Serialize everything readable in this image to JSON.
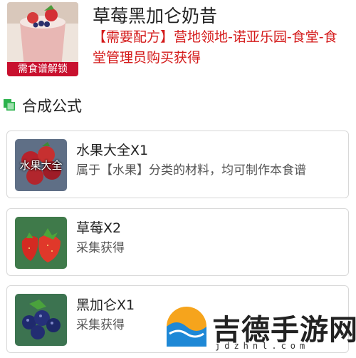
{
  "recipe": {
    "title": "草莓黑加仑奶昔",
    "source": "【需要配方】营地领地-诺亚乐园-食堂-食堂管理员购买获得",
    "unlock_label": "需食谱解锁",
    "image_icon": "smoothie-cup-icon"
  },
  "section": {
    "title": "合成公式",
    "icon": "green-square-icon"
  },
  "ingredients": [
    {
      "name": "水果大全X1",
      "desc": "属于【水果】分类的材料，均可制作本食谱",
      "thumb_label": "水果大全",
      "icon": "mixed-fruit-icon"
    },
    {
      "name": "草莓X2",
      "desc": "采集获得",
      "icon": "strawberry-icon"
    },
    {
      "name": "黑加仑X1",
      "desc": "采集获得",
      "icon": "blackcurrant-icon"
    }
  ],
  "watermark": {
    "text": "吉德手游网",
    "url": "jdzhnl.com",
    "icon": "wave-logo-icon"
  },
  "colors": {
    "accent_red": "#d41a1a",
    "banner_red": "#c8102e",
    "section_green": "#2bb24c"
  }
}
